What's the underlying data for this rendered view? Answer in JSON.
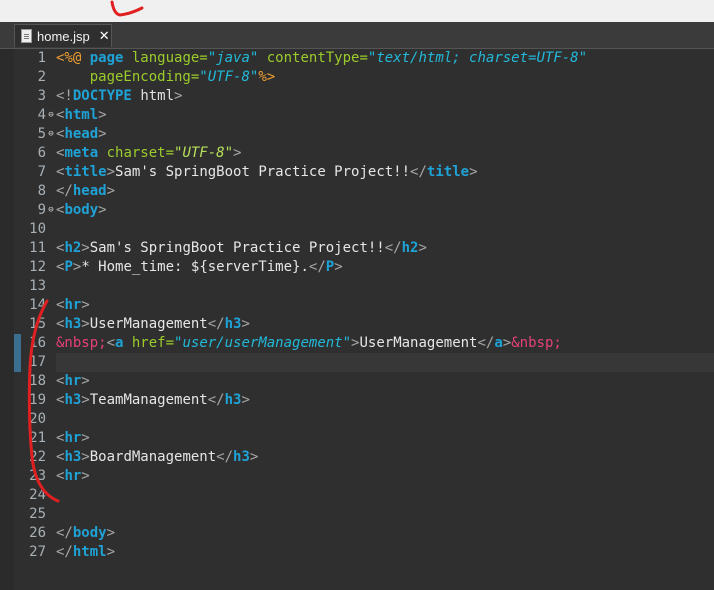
{
  "tab": {
    "label": "home.jsp",
    "close": "✕"
  },
  "gutter": {
    "lines": [
      {
        "n": "1",
        "fold": ""
      },
      {
        "n": "2",
        "fold": ""
      },
      {
        "n": "3",
        "fold": ""
      },
      {
        "n": "4",
        "fold": "⊖"
      },
      {
        "n": "5",
        "fold": "⊖"
      },
      {
        "n": "6",
        "fold": ""
      },
      {
        "n": "7",
        "fold": ""
      },
      {
        "n": "8",
        "fold": ""
      },
      {
        "n": "9",
        "fold": "⊖"
      },
      {
        "n": "10",
        "fold": ""
      },
      {
        "n": "11",
        "fold": ""
      },
      {
        "n": "12",
        "fold": ""
      },
      {
        "n": "13",
        "fold": ""
      },
      {
        "n": "14",
        "fold": ""
      },
      {
        "n": "15",
        "fold": ""
      },
      {
        "n": "16",
        "fold": ""
      },
      {
        "n": "17",
        "fold": ""
      },
      {
        "n": "18",
        "fold": ""
      },
      {
        "n": "19",
        "fold": ""
      },
      {
        "n": "20",
        "fold": ""
      },
      {
        "n": "21",
        "fold": ""
      },
      {
        "n": "22",
        "fold": ""
      },
      {
        "n": "23",
        "fold": ""
      },
      {
        "n": "24",
        "fold": ""
      },
      {
        "n": "25",
        "fold": ""
      },
      {
        "n": "26",
        "fold": ""
      },
      {
        "n": "27",
        "fold": ""
      }
    ]
  },
  "code": [
    [
      [
        "d",
        "<%@ "
      ],
      [
        "t",
        "page"
      ],
      [
        "a",
        " language="
      ],
      [
        "v",
        "\"java\""
      ],
      [
        "a",
        " contentType="
      ],
      [
        "v",
        "\"text/html; charset=UTF-8\""
      ]
    ],
    [
      [
        "x",
        "    "
      ],
      [
        "a",
        "pageEncoding="
      ],
      [
        "v",
        "\"UTF-8\""
      ],
      [
        "d",
        "%>"
      ]
    ],
    [
      [
        "d",
        "<!"
      ],
      [
        "t",
        "DOCTYPE"
      ],
      [
        "x",
        " "
      ],
      [
        "dt",
        "html"
      ],
      [
        "d",
        ">"
      ]
    ],
    [
      [
        "d",
        "<"
      ],
      [
        "t",
        "html"
      ],
      [
        "d",
        ">"
      ]
    ],
    [
      [
        "d",
        "<"
      ],
      [
        "t",
        "head"
      ],
      [
        "d",
        ">"
      ]
    ],
    [
      [
        "d",
        "<"
      ],
      [
        "t",
        "meta"
      ],
      [
        "a",
        " charset="
      ],
      [
        "v2",
        "\"UTF-8\""
      ],
      [
        "d",
        ">"
      ]
    ],
    [
      [
        "d",
        "<"
      ],
      [
        "t",
        "title"
      ],
      [
        "d",
        ">"
      ],
      [
        "x",
        "Sam's SpringBoot Practice Project!!"
      ],
      [
        "d",
        "</"
      ],
      [
        "t",
        "title"
      ],
      [
        "d",
        ">"
      ]
    ],
    [
      [
        "d",
        "</"
      ],
      [
        "t",
        "head"
      ],
      [
        "d",
        ">"
      ]
    ],
    [
      [
        "d",
        "<"
      ],
      [
        "t",
        "body"
      ],
      [
        "d",
        ">"
      ]
    ],
    [],
    [
      [
        "d",
        "<"
      ],
      [
        "t",
        "h2"
      ],
      [
        "d",
        ">"
      ],
      [
        "x",
        "Sam's SpringBoot Practice Project!!"
      ],
      [
        "d",
        "</"
      ],
      [
        "t",
        "h2"
      ],
      [
        "d",
        ">"
      ]
    ],
    [
      [
        "d",
        "<"
      ],
      [
        "t",
        "P"
      ],
      [
        "d",
        ">"
      ],
      [
        "x",
        "* Home_time: ${serverTime}."
      ],
      [
        "d",
        "</"
      ],
      [
        "t",
        "P"
      ],
      [
        "d",
        ">"
      ]
    ],
    [],
    [
      [
        "d",
        "<"
      ],
      [
        "t",
        "hr"
      ],
      [
        "d",
        ">"
      ]
    ],
    [
      [
        "d",
        "<"
      ],
      [
        "t",
        "h3"
      ],
      [
        "d",
        ">"
      ],
      [
        "x",
        "UserManagement"
      ],
      [
        "d",
        "</"
      ],
      [
        "t",
        "h3"
      ],
      [
        "d",
        ">"
      ]
    ],
    [
      [
        "e",
        "&nbsp;"
      ],
      [
        "d",
        "<"
      ],
      [
        "t",
        "a"
      ],
      [
        "a",
        " href="
      ],
      [
        "v",
        "\"user/userManagement\""
      ],
      [
        "d",
        ">"
      ],
      [
        "x",
        "UserManagement"
      ],
      [
        "d",
        "</"
      ],
      [
        "t",
        "a"
      ],
      [
        "d",
        ">"
      ],
      [
        "e",
        "&nbsp;"
      ]
    ],
    [],
    [
      [
        "d",
        "<"
      ],
      [
        "t",
        "hr"
      ],
      [
        "d",
        ">"
      ]
    ],
    [
      [
        "d",
        "<"
      ],
      [
        "t",
        "h3"
      ],
      [
        "d",
        ">"
      ],
      [
        "x",
        "TeamManagement"
      ],
      [
        "d",
        "</"
      ],
      [
        "t",
        "h3"
      ],
      [
        "d",
        ">"
      ]
    ],
    [],
    [
      [
        "d",
        "<"
      ],
      [
        "t",
        "hr"
      ],
      [
        "d",
        ">"
      ]
    ],
    [
      [
        "d",
        "<"
      ],
      [
        "t",
        "h3"
      ],
      [
        "d",
        ">"
      ],
      [
        "x",
        "BoardManagement"
      ],
      [
        "d",
        "</"
      ],
      [
        "t",
        "h3"
      ],
      [
        "d",
        ">"
      ]
    ],
    [
      [
        "d",
        "<"
      ],
      [
        "t",
        "hr"
      ],
      [
        "d",
        ">"
      ]
    ],
    [],
    [],
    [
      [
        "d",
        "</"
      ],
      [
        "t",
        "body"
      ],
      [
        "d",
        ">"
      ]
    ],
    [
      [
        "d",
        "</"
      ],
      [
        "t",
        "html"
      ],
      [
        "d",
        ">"
      ]
    ]
  ],
  "colors": {
    "editor_bg": "#2f2f2f",
    "tag": "#1fa2d6",
    "attribute": "#9ccc2c",
    "value": "#22b9d8",
    "entity": "#e8407a",
    "annotation": "#e02020"
  }
}
